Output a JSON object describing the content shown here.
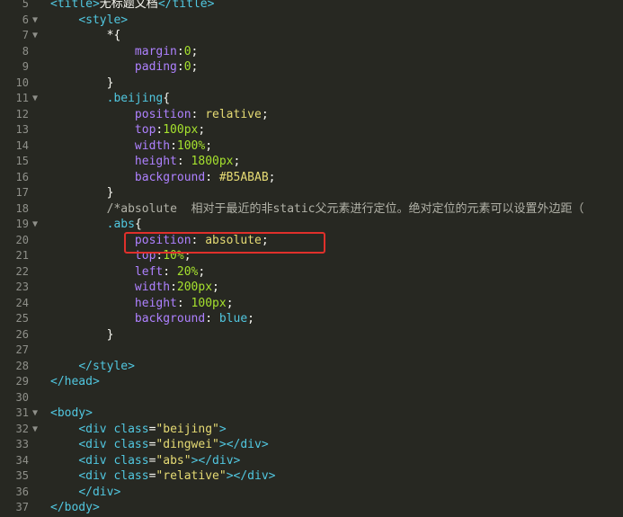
{
  "lines": [
    {
      "n": "5",
      "fold": "",
      "segments": [
        {
          "t": "<title>",
          "c": "tag"
        },
        {
          "t": "无标题文档",
          "c": "punct"
        },
        {
          "t": "</title>",
          "c": "tag"
        }
      ]
    },
    {
      "n": "6",
      "fold": "▼",
      "segments": [
        {
          "t": "    ",
          "c": "punct"
        },
        {
          "t": "<style>",
          "c": "tag"
        }
      ]
    },
    {
      "n": "7",
      "fold": "▼",
      "segments": [
        {
          "t": "        *{",
          "c": "punct"
        }
      ]
    },
    {
      "n": "8",
      "fold": "",
      "segments": [
        {
          "t": "            ",
          "c": "punct"
        },
        {
          "t": "margin",
          "c": "kw"
        },
        {
          "t": ":",
          "c": "punct"
        },
        {
          "t": "0",
          "c": "num"
        },
        {
          "t": ";",
          "c": "punct"
        }
      ]
    },
    {
      "n": "9",
      "fold": "",
      "segments": [
        {
          "t": "            ",
          "c": "punct"
        },
        {
          "t": "pading",
          "c": "kw"
        },
        {
          "t": ":",
          "c": "punct"
        },
        {
          "t": "0",
          "c": "num"
        },
        {
          "t": ";",
          "c": "punct"
        }
      ]
    },
    {
      "n": "10",
      "fold": "",
      "segments": [
        {
          "t": "        }",
          "c": "punct"
        }
      ]
    },
    {
      "n": "11",
      "fold": "▼",
      "segments": [
        {
          "t": "        ",
          "c": "punct"
        },
        {
          "t": ".beijing",
          "c": "tag"
        },
        {
          "t": "{",
          "c": "punct"
        }
      ]
    },
    {
      "n": "12",
      "fold": "",
      "segments": [
        {
          "t": "            ",
          "c": "punct"
        },
        {
          "t": "position",
          "c": "kw"
        },
        {
          "t": ": ",
          "c": "punct"
        },
        {
          "t": "relative",
          "c": "str"
        },
        {
          "t": ";",
          "c": "punct"
        }
      ]
    },
    {
      "n": "13",
      "fold": "",
      "segments": [
        {
          "t": "            ",
          "c": "punct"
        },
        {
          "t": "top",
          "c": "kw"
        },
        {
          "t": ":",
          "c": "punct"
        },
        {
          "t": "100px",
          "c": "num"
        },
        {
          "t": ";",
          "c": "punct"
        }
      ]
    },
    {
      "n": "14",
      "fold": "",
      "segments": [
        {
          "t": "            ",
          "c": "punct"
        },
        {
          "t": "width",
          "c": "kw"
        },
        {
          "t": ":",
          "c": "punct"
        },
        {
          "t": "100%",
          "c": "num"
        },
        {
          "t": ";",
          "c": "punct"
        }
      ]
    },
    {
      "n": "15",
      "fold": "",
      "segments": [
        {
          "t": "            ",
          "c": "punct"
        },
        {
          "t": "height",
          "c": "kw"
        },
        {
          "t": ": ",
          "c": "punct"
        },
        {
          "t": "1800px",
          "c": "num"
        },
        {
          "t": ";",
          "c": "punct"
        }
      ]
    },
    {
      "n": "16",
      "fold": "",
      "segments": [
        {
          "t": "            ",
          "c": "punct"
        },
        {
          "t": "background",
          "c": "kw"
        },
        {
          "t": ": ",
          "c": "punct"
        },
        {
          "t": "#B5ABAB",
          "c": "str"
        },
        {
          "t": ";",
          "c": "punct"
        }
      ]
    },
    {
      "n": "17",
      "fold": "",
      "segments": [
        {
          "t": "        }",
          "c": "punct"
        }
      ]
    },
    {
      "n": "18",
      "fold": "",
      "segments": [
        {
          "t": "        ",
          "c": "punct"
        },
        {
          "t": "/*absolute  相对于最近的非static父元素进行定位。绝对定位的元素可以设置外边距（",
          "c": "cmt"
        }
      ]
    },
    {
      "n": "19",
      "fold": "▼",
      "segments": [
        {
          "t": "        ",
          "c": "punct"
        },
        {
          "t": ".abs",
          "c": "tag"
        },
        {
          "t": "{",
          "c": "punct"
        }
      ]
    },
    {
      "n": "20",
      "fold": "",
      "segments": [
        {
          "t": "            ",
          "c": "punct"
        },
        {
          "t": "position",
          "c": "kw"
        },
        {
          "t": ": ",
          "c": "punct"
        },
        {
          "t": "absolute",
          "c": "str"
        },
        {
          "t": ";",
          "c": "punct"
        }
      ]
    },
    {
      "n": "21",
      "fold": "",
      "segments": [
        {
          "t": "            ",
          "c": "punct"
        },
        {
          "t": "top",
          "c": "kw"
        },
        {
          "t": ":",
          "c": "punct"
        },
        {
          "t": "10%",
          "c": "num"
        },
        {
          "t": ";",
          "c": "punct"
        }
      ]
    },
    {
      "n": "22",
      "fold": "",
      "segments": [
        {
          "t": "            ",
          "c": "punct"
        },
        {
          "t": "left",
          "c": "kw"
        },
        {
          "t": ": ",
          "c": "punct"
        },
        {
          "t": "20%",
          "c": "num"
        },
        {
          "t": ";",
          "c": "punct"
        }
      ]
    },
    {
      "n": "23",
      "fold": "",
      "segments": [
        {
          "t": "            ",
          "c": "punct"
        },
        {
          "t": "width",
          "c": "kw"
        },
        {
          "t": ":",
          "c": "punct"
        },
        {
          "t": "200px",
          "c": "num"
        },
        {
          "t": ";",
          "c": "punct"
        }
      ]
    },
    {
      "n": "24",
      "fold": "",
      "segments": [
        {
          "t": "            ",
          "c": "punct"
        },
        {
          "t": "height",
          "c": "kw"
        },
        {
          "t": ": ",
          "c": "punct"
        },
        {
          "t": "100px",
          "c": "num"
        },
        {
          "t": ";",
          "c": "punct"
        }
      ]
    },
    {
      "n": "25",
      "fold": "",
      "segments": [
        {
          "t": "            ",
          "c": "punct"
        },
        {
          "t": "background",
          "c": "kw"
        },
        {
          "t": ": ",
          "c": "punct"
        },
        {
          "t": "blue",
          "c": "attr"
        },
        {
          "t": ";",
          "c": "punct"
        }
      ]
    },
    {
      "n": "26",
      "fold": "",
      "segments": [
        {
          "t": "        }",
          "c": "punct"
        }
      ]
    },
    {
      "n": "27",
      "fold": "",
      "segments": []
    },
    {
      "n": "28",
      "fold": "",
      "segments": [
        {
          "t": "    ",
          "c": "punct"
        },
        {
          "t": "</style>",
          "c": "tag"
        }
      ]
    },
    {
      "n": "29",
      "fold": "",
      "segments": [
        {
          "t": "</head>",
          "c": "tag"
        }
      ]
    },
    {
      "n": "30",
      "fold": "",
      "segments": []
    },
    {
      "n": "31",
      "fold": "▼",
      "segments": [
        {
          "t": "<body>",
          "c": "tag"
        }
      ]
    },
    {
      "n": "32",
      "fold": "▼",
      "segments": [
        {
          "t": "    ",
          "c": "punct"
        },
        {
          "t": "<div ",
          "c": "tag"
        },
        {
          "t": "class",
          "c": "attr"
        },
        {
          "t": "=",
          "c": "punct"
        },
        {
          "t": "\"beijing\"",
          "c": "str"
        },
        {
          "t": ">",
          "c": "tag"
        }
      ]
    },
    {
      "n": "33",
      "fold": "",
      "segments": [
        {
          "t": "    ",
          "c": "punct"
        },
        {
          "t": "<div ",
          "c": "tag"
        },
        {
          "t": "class",
          "c": "attr"
        },
        {
          "t": "=",
          "c": "punct"
        },
        {
          "t": "\"dingwei\"",
          "c": "str"
        },
        {
          "t": "></div>",
          "c": "tag"
        }
      ]
    },
    {
      "n": "34",
      "fold": "",
      "segments": [
        {
          "t": "    ",
          "c": "punct"
        },
        {
          "t": "<div ",
          "c": "tag"
        },
        {
          "t": "class",
          "c": "attr"
        },
        {
          "t": "=",
          "c": "punct"
        },
        {
          "t": "\"abs\"",
          "c": "str"
        },
        {
          "t": "></div>",
          "c": "tag"
        }
      ]
    },
    {
      "n": "35",
      "fold": "",
      "segments": [
        {
          "t": "    ",
          "c": "punct"
        },
        {
          "t": "<div ",
          "c": "tag"
        },
        {
          "t": "class",
          "c": "attr"
        },
        {
          "t": "=",
          "c": "punct"
        },
        {
          "t": "\"relative\"",
          "c": "str"
        },
        {
          "t": "></div>",
          "c": "tag"
        }
      ]
    },
    {
      "n": "36",
      "fold": "",
      "segments": [
        {
          "t": "    ",
          "c": "punct"
        },
        {
          "t": "</div>",
          "c": "tag"
        }
      ]
    },
    {
      "n": "37",
      "fold": "",
      "segments": [
        {
          "t": "</body>",
          "c": "tag"
        }
      ]
    }
  ],
  "colors": {
    "background": "#272822",
    "highlight_box": "#e0302b"
  }
}
